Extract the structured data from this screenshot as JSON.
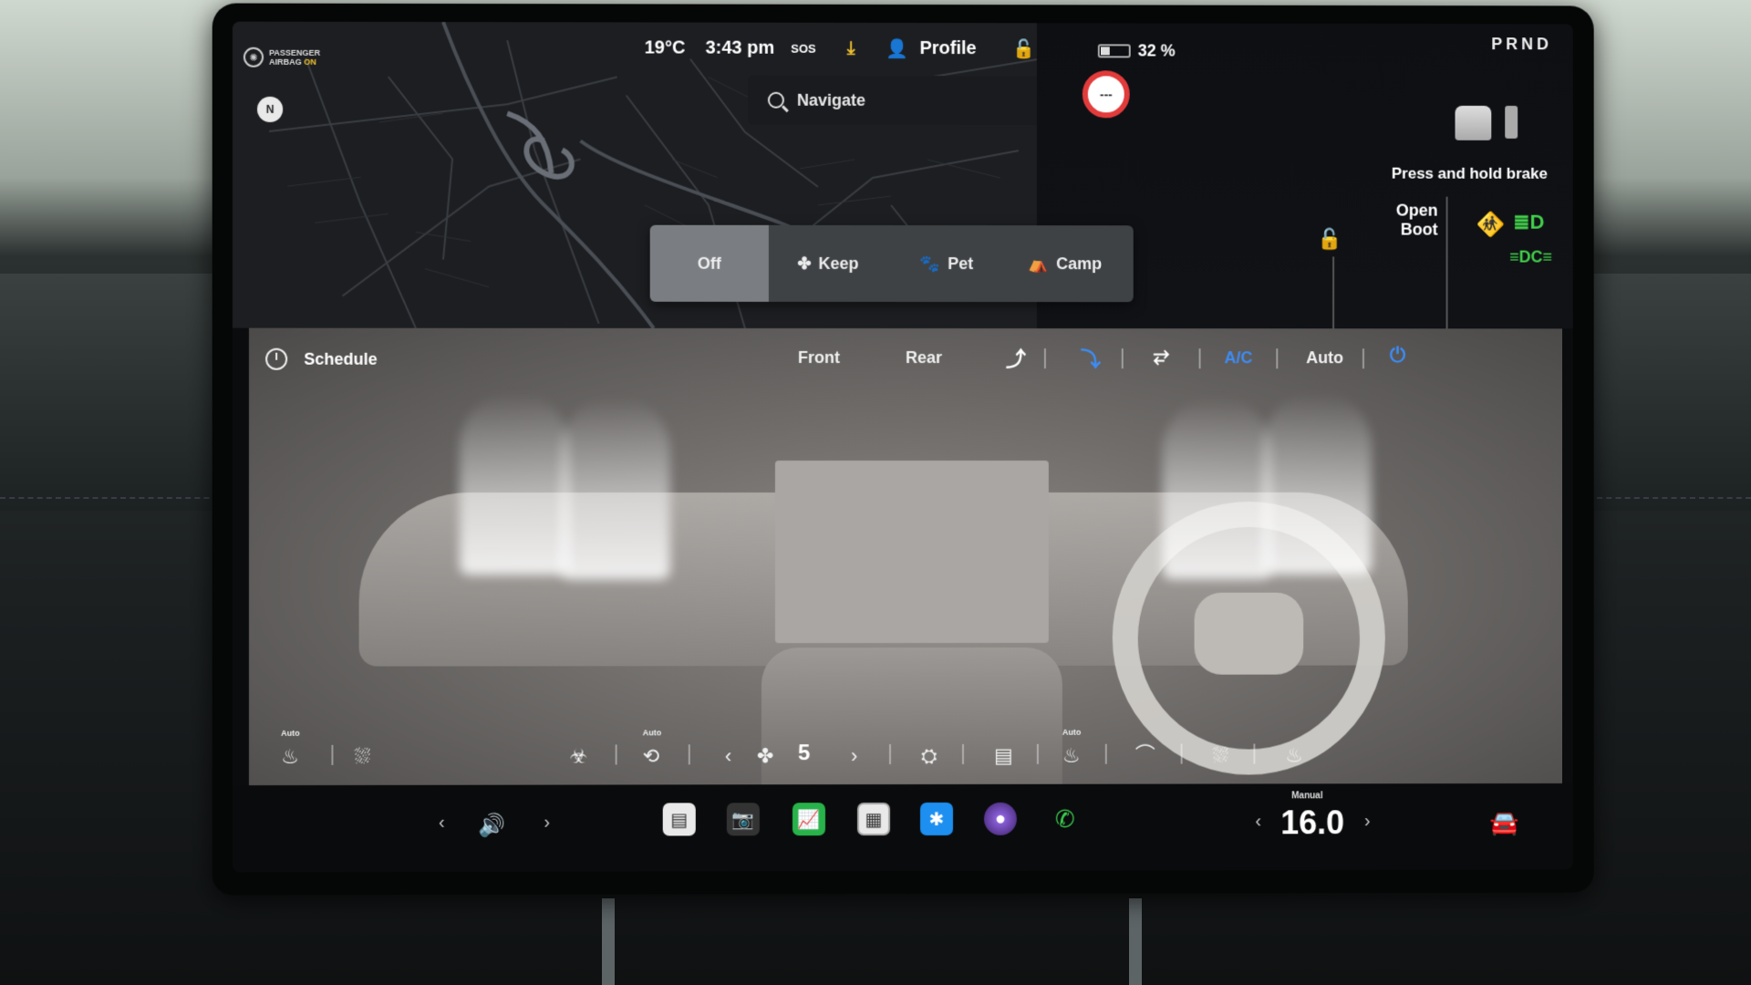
{
  "status": {
    "airbag_line1": "PASSENGER",
    "airbag_line2": "AIRBAG",
    "airbag_state": "ON",
    "compass": "N",
    "outside_temp": "19°C",
    "time": "3:43 pm",
    "sos": "SOS",
    "profile": "Profile",
    "battery_percent": "32 %",
    "battery_level": 0.32,
    "speed_limit": "---",
    "gear": "PRND"
  },
  "navigation": {
    "search_label": "Navigate"
  },
  "drive_panel": {
    "brake_hint": "Press and hold brake",
    "open_boot_line1": "Open",
    "open_boot_line2": "Boot"
  },
  "keep_mode": {
    "options": [
      "Off",
      "Keep",
      "Pet",
      "Camp"
    ],
    "selected": "Off"
  },
  "climate": {
    "schedule": "Schedule",
    "tabs": [
      "Front",
      "Rear"
    ],
    "ac": "A/C",
    "auto": "Auto",
    "fan_speed": "5",
    "seat_heat_auto": "Auto",
    "recirc_auto": "Auto",
    "steering_heat_auto": "Auto"
  },
  "dock": {
    "cabin_temp": "16.0",
    "cabin_mode": "Manual"
  },
  "colors": {
    "accent_blue": "#3d8cf5",
    "warning_red": "#e5484d",
    "light_green": "#43d14b",
    "airbag_on": "#f2c230"
  }
}
